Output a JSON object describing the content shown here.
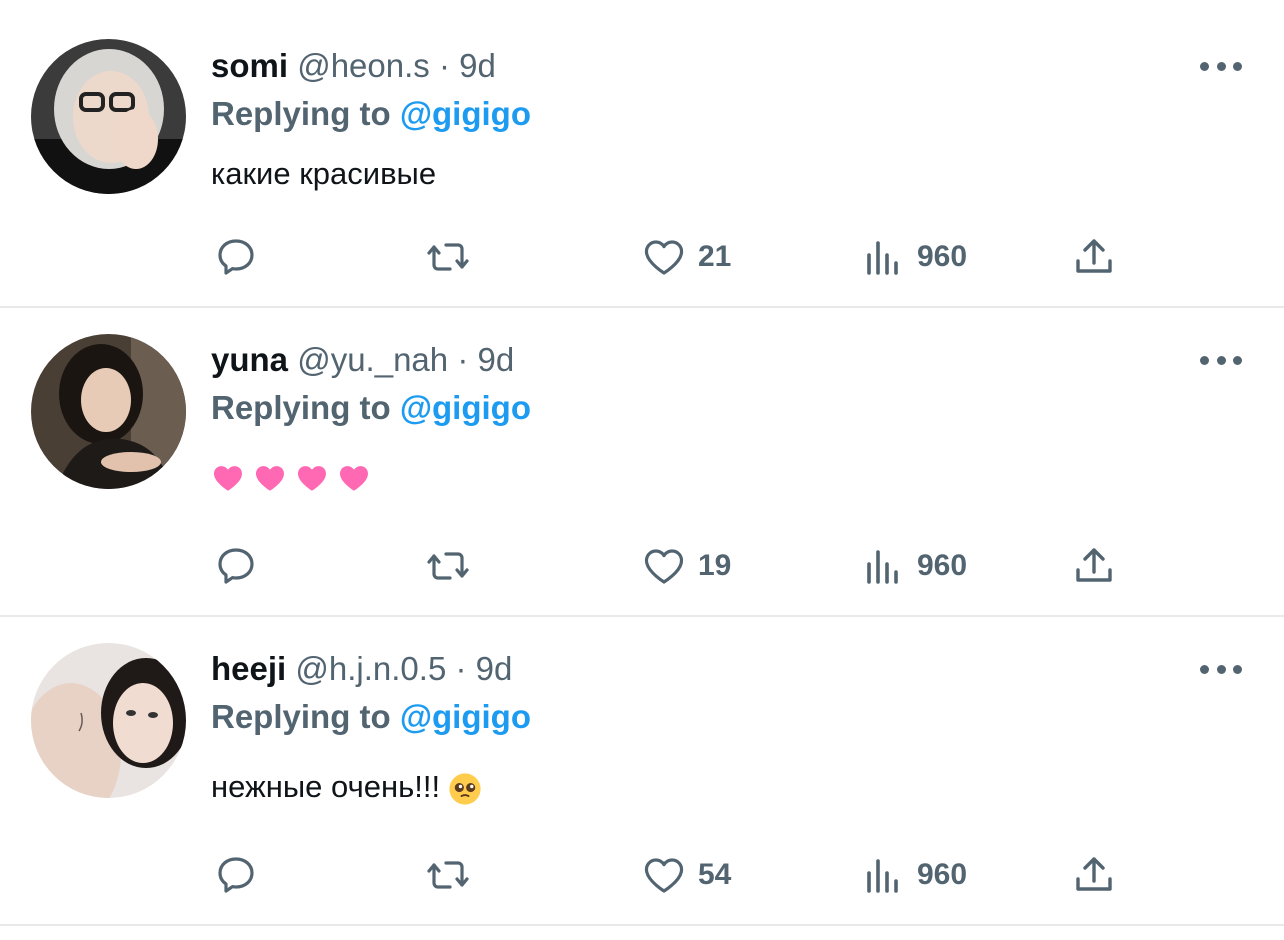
{
  "tweets": [
    {
      "name": "somi",
      "handle": "@heon.s",
      "separator": "·",
      "time": "9d",
      "replying_prefix": "Replying to",
      "replying_to": "@gigigo",
      "text": "какие красивые",
      "likes": "21",
      "views": "960"
    },
    {
      "name": "yuna",
      "handle": "@yu._nah",
      "separator": "·",
      "time": "9d",
      "replying_prefix": "Replying to",
      "replying_to": "@gigigo",
      "text_emojis": [
        "pink-heart",
        "pink-heart",
        "pink-heart",
        "pink-heart"
      ],
      "likes": "19",
      "views": "960"
    },
    {
      "name": "heeji",
      "handle": "@h.j.n.0.5",
      "separator": "·",
      "time": "9d",
      "replying_prefix": "Replying to",
      "replying_to": "@gigigo",
      "text": "нежные очень!!!",
      "text_emoji": "pleading-face",
      "likes": "54",
      "views": "960"
    }
  ],
  "icons": {
    "reply": "comment-bubble-icon",
    "retweet": "retweet-icon",
    "like": "heart-icon",
    "views": "bar-chart-icon",
    "share": "share-upload-icon",
    "more": "more-dots-icon"
  },
  "colors": {
    "text": "#0f1419",
    "secondary": "#536471",
    "link": "#1d9bf0",
    "divider": "#e7e9ea",
    "pink_heart": "#ff69b4"
  }
}
